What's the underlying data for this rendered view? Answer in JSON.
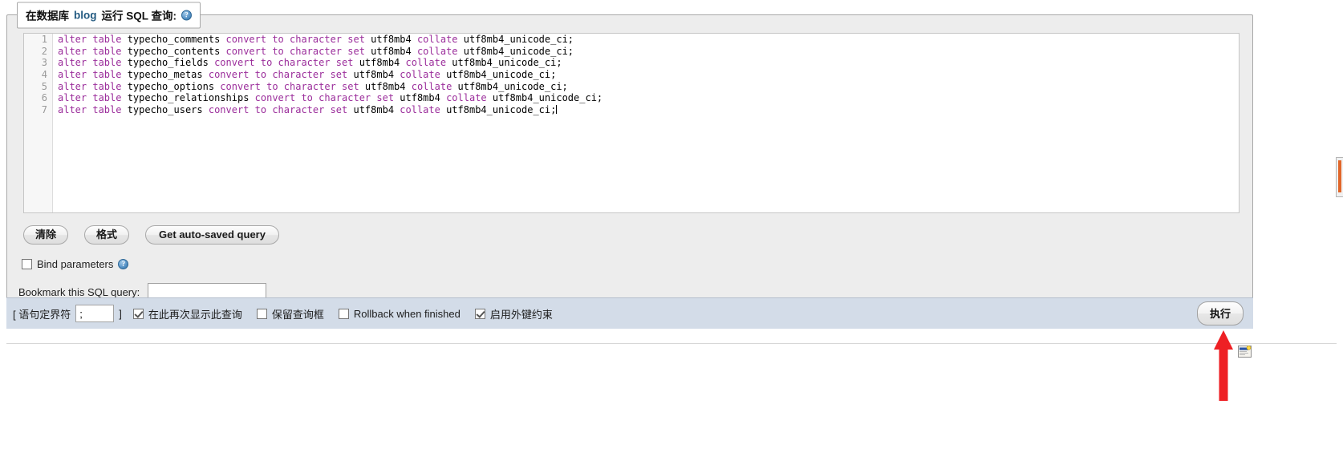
{
  "legend": {
    "prefix": "在数据库",
    "db_name": "blog",
    "suffix": "运行 SQL 查询:",
    "help_icon": "help-circle-icon",
    "help_glyph": "?"
  },
  "editor": {
    "line_numbers": [
      "1",
      "2",
      "3",
      "4",
      "5",
      "6",
      "7"
    ],
    "lines": [
      [
        {
          "t": "alter table ",
          "k": true
        },
        {
          "t": "typecho_comments ",
          "k": false
        },
        {
          "t": "convert to character set ",
          "k": true
        },
        {
          "t": "utf8mb4 ",
          "k": false
        },
        {
          "t": "collate ",
          "k": true
        },
        {
          "t": "utf8mb4_unicode_ci;",
          "k": false
        }
      ],
      [
        {
          "t": "alter table ",
          "k": true
        },
        {
          "t": "typecho_contents ",
          "k": false
        },
        {
          "t": "convert to character set ",
          "k": true
        },
        {
          "t": "utf8mb4 ",
          "k": false
        },
        {
          "t": "collate ",
          "k": true
        },
        {
          "t": "utf8mb4_unicode_ci;",
          "k": false
        }
      ],
      [
        {
          "t": "alter table ",
          "k": true
        },
        {
          "t": "typecho_fields ",
          "k": false
        },
        {
          "t": "convert to character set ",
          "k": true
        },
        {
          "t": "utf8mb4 ",
          "k": false
        },
        {
          "t": "collate ",
          "k": true
        },
        {
          "t": "utf8mb4_unicode_ci;",
          "k": false
        }
      ],
      [
        {
          "t": "alter table ",
          "k": true
        },
        {
          "t": "typecho_metas ",
          "k": false
        },
        {
          "t": "convert to character set ",
          "k": true
        },
        {
          "t": "utf8mb4 ",
          "k": false
        },
        {
          "t": "collate ",
          "k": true
        },
        {
          "t": "utf8mb4_unicode_ci;",
          "k": false
        }
      ],
      [
        {
          "t": "alter table ",
          "k": true
        },
        {
          "t": "typecho_options ",
          "k": false
        },
        {
          "t": "convert to character set ",
          "k": true
        },
        {
          "t": "utf8mb4 ",
          "k": false
        },
        {
          "t": "collate ",
          "k": true
        },
        {
          "t": "utf8mb4_unicode_ci;",
          "k": false
        }
      ],
      [
        {
          "t": "alter table ",
          "k": true
        },
        {
          "t": "typecho_relationships ",
          "k": false
        },
        {
          "t": "convert to character set ",
          "k": true
        },
        {
          "t": "utf8mb4 ",
          "k": false
        },
        {
          "t": "collate ",
          "k": true
        },
        {
          "t": "utf8mb4_unicode_ci;",
          "k": false
        }
      ],
      [
        {
          "t": "alter table ",
          "k": true
        },
        {
          "t": "typecho_users ",
          "k": false
        },
        {
          "t": "convert to character set ",
          "k": true
        },
        {
          "t": "utf8mb4 ",
          "k": false
        },
        {
          "t": "collate ",
          "k": true
        },
        {
          "t": "utf8mb4_unicode_ci;",
          "k": false
        }
      ]
    ]
  },
  "buttons": {
    "clear": "清除",
    "format": "格式",
    "auto_saved": "Get auto-saved query"
  },
  "bind": {
    "label": "Bind parameters",
    "checked": false,
    "help_icon": "help-circle-icon",
    "help_glyph": "?"
  },
  "bookmark": {
    "label": "Bookmark this SQL query:",
    "value": "",
    "placeholder": ""
  },
  "footer": {
    "delimiter_open": "[ 语句定界符",
    "delimiter_value": ";",
    "delimiter_close": "]",
    "checkboxes": [
      {
        "label": "在此再次显示此查询",
        "checked": true
      },
      {
        "label": "保留查询框",
        "checked": false
      },
      {
        "label": "Rollback when finished",
        "checked": false
      },
      {
        "label": "启用外键约束",
        "checked": true
      }
    ],
    "go_button": "执行"
  },
  "annotation": {
    "arrow_icon": "red-up-arrow-icon",
    "arrow_color": "#ee2024",
    "note_icon": "sticky-note-icon"
  },
  "colors": {
    "panel_bg": "#ededed",
    "footer_bg": "#d3dce8",
    "keyword": "#9b2d9b",
    "db_name": "#235a81",
    "scroll_thumb": "#e1662a"
  }
}
